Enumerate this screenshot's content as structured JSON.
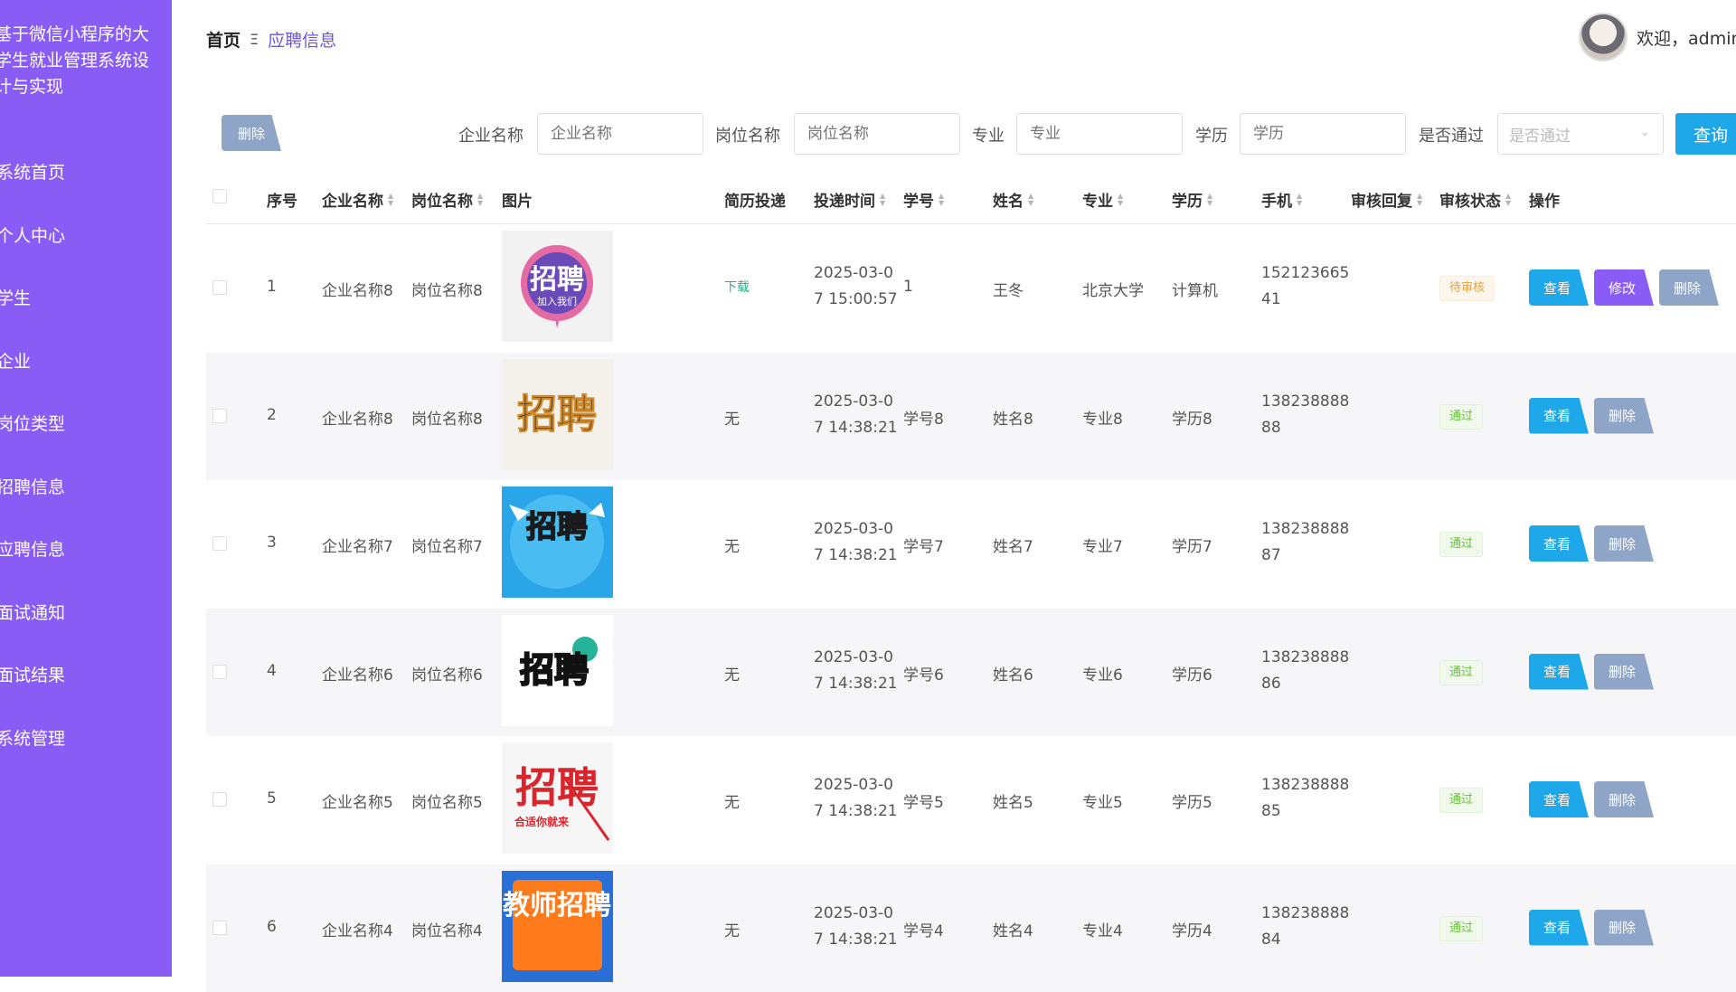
{
  "sidebar": {
    "title": "基于微信小程序的大学生就业管理系统设计与实现",
    "items": [
      {
        "label": "系统首页"
      },
      {
        "label": "个人中心"
      },
      {
        "label": "学生"
      },
      {
        "label": "企业"
      },
      {
        "label": "岗位类型"
      },
      {
        "label": "招聘信息"
      },
      {
        "label": "应聘信息"
      },
      {
        "label": "面试通知"
      },
      {
        "label": "面试结果"
      },
      {
        "label": "系统管理"
      }
    ]
  },
  "header": {
    "breadcrumb_home": "首页",
    "breadcrumb_sep": "Ξ",
    "breadcrumb_current": "应聘信息",
    "welcome": "欢迎，admin"
  },
  "filters": {
    "batch_delete": "删除",
    "company_label": "企业名称",
    "company_placeholder": "企业名称",
    "position_label": "岗位名称",
    "position_placeholder": "岗位名称",
    "major_label": "专业",
    "major_placeholder": "专业",
    "education_label": "学历",
    "education_placeholder": "学历",
    "passed_label": "是否通过",
    "passed_placeholder": "是否通过",
    "query_button": "查询"
  },
  "table": {
    "headers": {
      "index": "序号",
      "company": "企业名称",
      "position": "岗位名称",
      "image": "图片",
      "resume": "简历投递",
      "time": "投递时间",
      "student_no": "学号",
      "name": "姓名",
      "major": "专业",
      "education": "学历",
      "phone": "手机",
      "reply": "审核回复",
      "status": "审核状态",
      "actions": "操作"
    },
    "rows": [
      {
        "index": "1",
        "company": "企业名称8",
        "position": "岗位名称8",
        "image_text": "招聘",
        "image_sub": "加入我们",
        "resume": "下载",
        "time": "2025-03-0 7 15:00:57",
        "student_no": "1",
        "name": "王冬",
        "major": "北京大学",
        "education": "计算机",
        "phone": "152123665 41",
        "status": "待审核",
        "view": "查看",
        "edit": "修改",
        "delete": "删除"
      },
      {
        "index": "2",
        "company": "企业名称8",
        "position": "岗位名称8",
        "image_text": "招聘",
        "image_sub": "",
        "resume": "无",
        "time": "2025-03-0 7 14:38:21",
        "student_no": "学号8",
        "name": "姓名8",
        "major": "专业8",
        "education": "学历8",
        "phone": "138238888 88",
        "status": "通过",
        "view": "查看",
        "delete": "删除"
      },
      {
        "index": "3",
        "company": "企业名称7",
        "position": "岗位名称7",
        "image_text": "招聘",
        "image_sub": "",
        "resume": "无",
        "time": "2025-03-0 7 14:38:21",
        "student_no": "学号7",
        "name": "姓名7",
        "major": "专业7",
        "education": "学历7",
        "phone": "138238888 87",
        "status": "通过",
        "view": "查看",
        "delete": "删除"
      },
      {
        "index": "4",
        "company": "企业名称6",
        "position": "岗位名称6",
        "image_text": "招聘",
        "image_sub": "",
        "resume": "无",
        "time": "2025-03-0 7 14:38:21",
        "student_no": "学号6",
        "name": "姓名6",
        "major": "专业6",
        "education": "学历6",
        "phone": "138238888 86",
        "status": "通过",
        "view": "查看",
        "delete": "删除"
      },
      {
        "index": "5",
        "company": "企业名称5",
        "position": "岗位名称5",
        "image_text": "招聘",
        "image_sub": "合适你就来",
        "resume": "无",
        "time": "2025-03-0 7 14:38:21",
        "student_no": "学号5",
        "name": "姓名5",
        "major": "专业5",
        "education": "学历5",
        "phone": "138238888 85",
        "status": "通过",
        "view": "查看",
        "delete": "删除"
      },
      {
        "index": "6",
        "company": "企业名称4",
        "position": "岗位名称4",
        "image_text": "教师招聘",
        "image_sub": "",
        "resume": "无",
        "time": "2025-03-0 7 14:38:21",
        "student_no": "学号4",
        "name": "姓名4",
        "major": "专业4",
        "education": "学历4",
        "phone": "138238888 84",
        "status": "通过",
        "view": "查看",
        "delete": "删除"
      }
    ]
  },
  "colors": {
    "sidebar": "#8a5cf6",
    "primary": "#1ea8ea",
    "edit": "#8a5cf6",
    "delete": "#8fa5c7",
    "pending": "#e6a23c",
    "pass": "#67c23a"
  }
}
